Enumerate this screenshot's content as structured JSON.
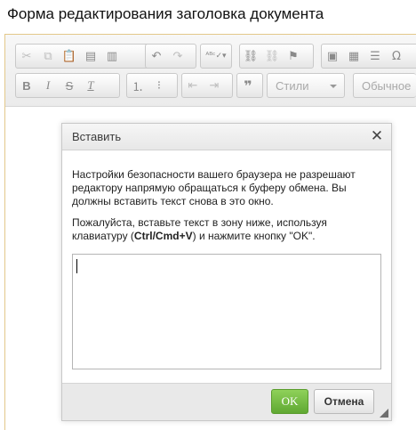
{
  "page": {
    "title": "Форма редактирования заголовка документа"
  },
  "toolbar": {
    "styles_combo": "Стили",
    "format_combo": "Обычное",
    "icons_row1": [
      "cut-icon",
      "copy-icon",
      "paste-icon",
      "paste-text-icon",
      "paste-word-icon",
      "undo-icon",
      "redo-icon",
      "spellcheck-icon",
      "link-icon",
      "unlink-icon",
      "anchor-icon",
      "image-icon",
      "table-icon",
      "horizontal-rule-icon",
      "special-char-icon"
    ],
    "icons_row2": [
      "bold-icon",
      "italic-icon",
      "strike-icon",
      "remove-format-icon",
      "numbered-list-icon",
      "bulleted-list-icon",
      "outdent-icon",
      "indent-icon",
      "blockquote-icon"
    ]
  },
  "dialog": {
    "title": "Вставить",
    "message1": "Настройки безопасности вашего браузера не разрешают редактору напрямую обращаться к буферу обмена. Вы должны вставить текст снова в это окно.",
    "message2_before": "Пожалуйста, вставьте текст в зону ниже, используя клавиатуру (",
    "message2_shortcut": "Ctrl/Cmd+V",
    "message2_after": ") и нажмите кнопку \"OK\".",
    "paste_value": "",
    "ok_label": "OK",
    "cancel_label": "Отмена"
  },
  "colors": {
    "ok_button": "#6fbb3d",
    "editor_border": "#e3c88a"
  }
}
